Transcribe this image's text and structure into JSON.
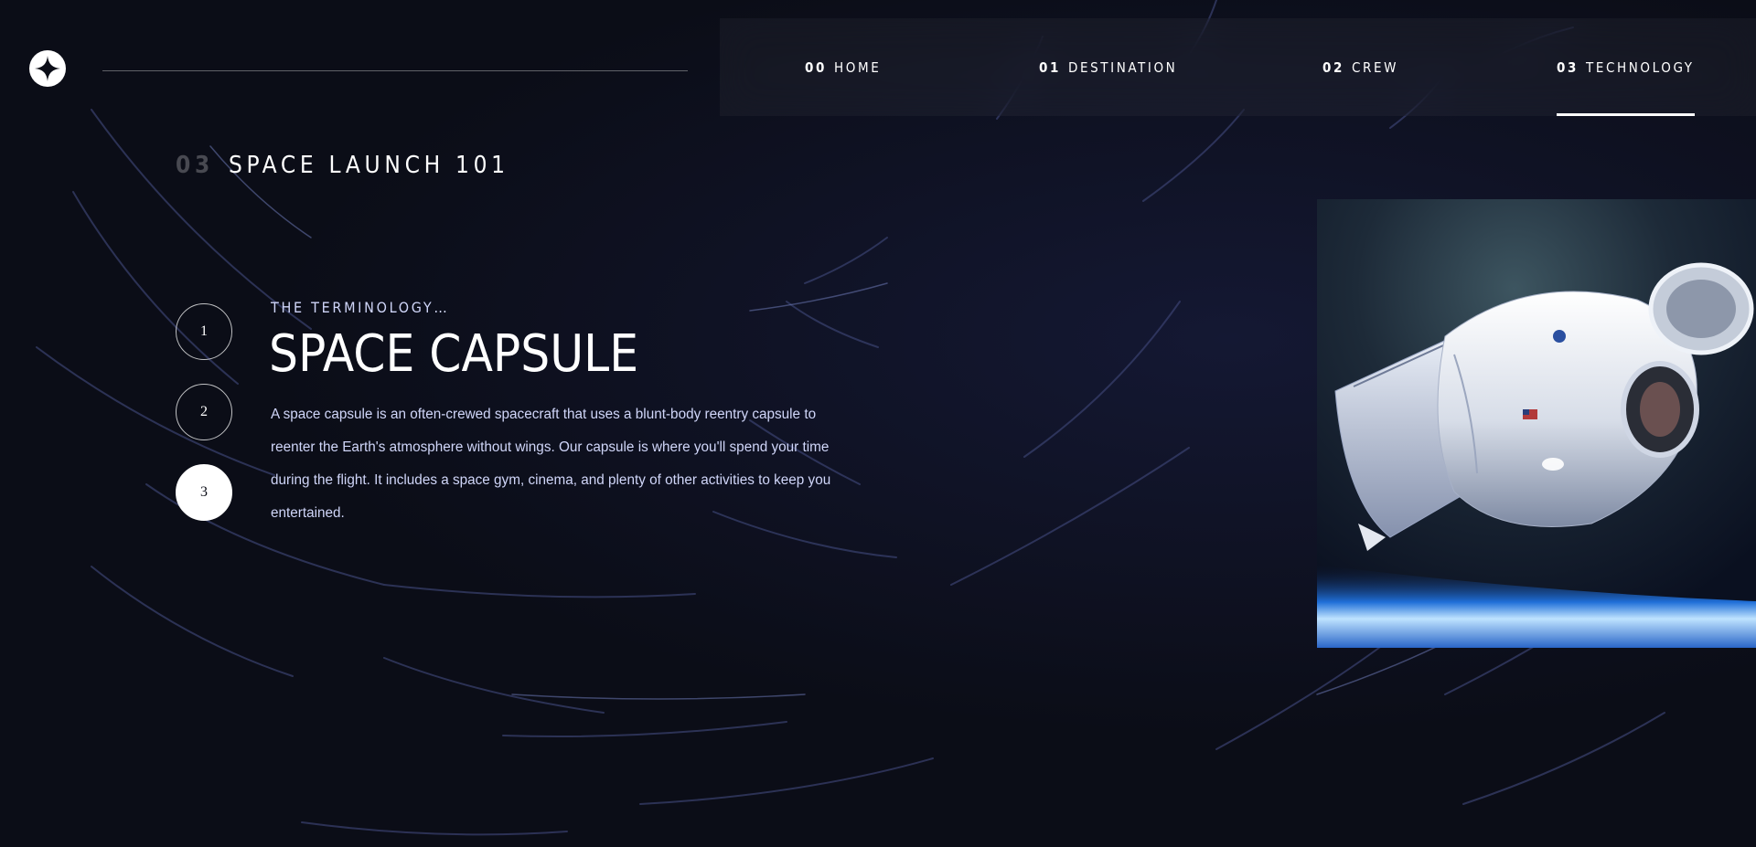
{
  "header": {
    "logo_icon": "star-icon",
    "nav": [
      {
        "number": "00",
        "label": "HOME",
        "active": false
      },
      {
        "number": "01",
        "label": "DESTINATION",
        "active": false
      },
      {
        "number": "02",
        "label": "CREW",
        "active": false
      },
      {
        "number": "03",
        "label": "TECHNOLOGY",
        "active": true
      }
    ]
  },
  "page": {
    "number": "03",
    "title": "SPACE LAUNCH 101"
  },
  "steps": [
    {
      "label": "1",
      "active": false
    },
    {
      "label": "2",
      "active": false
    },
    {
      "label": "3",
      "active": true
    }
  ],
  "technology": {
    "eyebrow": "THE TERMINOLOGY…",
    "name": "SPACE CAPSULE",
    "description": "A space capsule is an often-crewed spacecraft that uses a blunt-body reentry capsule to reenter the Earth's atmosphere without wings. Our capsule is where you'll spend your time during the flight. It includes a space gym, cinema, and plenty of other activities to keep you entertained.",
    "image_subject": "space-capsule-image"
  },
  "colors": {
    "background": "#0b0d17",
    "accent_light": "#d0d6f9",
    "white": "#ffffff"
  }
}
